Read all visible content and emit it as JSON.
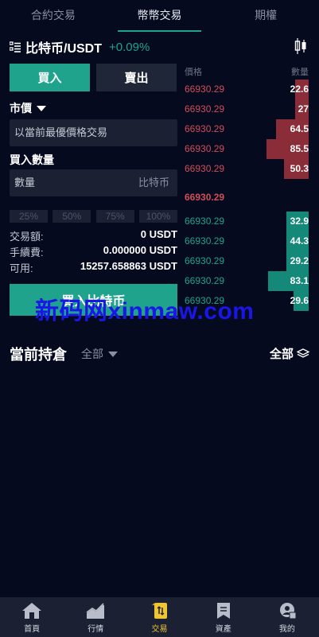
{
  "tabs": [
    "合約交易",
    "幣幣交易",
    "期權"
  ],
  "pair": {
    "name": "比特币/USDT",
    "change": "+0.09%"
  },
  "trade": {
    "buy_label": "買入",
    "sell_label": "賣出",
    "order_type": "市價",
    "price_placeholder": "以當前最優價格交易",
    "qty_label": "買入數量",
    "qty_placeholder": "數量",
    "qty_unit": "比特币",
    "percents": [
      "25%",
      "50%",
      "75%",
      "100%"
    ],
    "amount_label": "交易額:",
    "amount_value": "0 USDT",
    "fee_label": "手續費:",
    "fee_value": "0.000000 USDT",
    "avail_label": "可用:",
    "avail_value": "15257.658863 USDT",
    "submit_label": "買入比特币"
  },
  "orderbook": {
    "price_header": "價格",
    "qty_header": "數量",
    "mid_price": "66930.29",
    "asks": [
      {
        "price": "66930.29",
        "qty": "22.6",
        "depth": 0.11
      },
      {
        "price": "66930.29",
        "qty": "27",
        "depth": 0.11
      },
      {
        "price": "66930.29",
        "qty": "64.5",
        "depth": 0.26
      },
      {
        "price": "66930.29",
        "qty": "85.5",
        "depth": 0.34
      },
      {
        "price": "66930.29",
        "qty": "50.3",
        "depth": 0.2
      }
    ],
    "bids": [
      {
        "price": "66930.29",
        "qty": "32.9",
        "depth": 0.18
      },
      {
        "price": "66930.29",
        "qty": "44.3",
        "depth": 0.18
      },
      {
        "price": "66930.29",
        "qty": "29.2",
        "depth": 0.18
      },
      {
        "price": "66930.29",
        "qty": "83.1",
        "depth": 0.33
      },
      {
        "price": "66930.29",
        "qty": "29.6",
        "depth": 0.12
      }
    ]
  },
  "positions": {
    "title": "當前持倉",
    "filter": "全部",
    "all_label": "全部"
  },
  "watermark": "新码网xinmaw.com",
  "nav": [
    {
      "label": "首頁",
      "icon": "home-icon"
    },
    {
      "label": "行情",
      "icon": "chart-icon"
    },
    {
      "label": "交易",
      "icon": "trade-icon"
    },
    {
      "label": "資產",
      "icon": "wallet-icon"
    },
    {
      "label": "我的",
      "icon": "profile-icon"
    }
  ],
  "colors": {
    "accent": "#1fa38c",
    "ask": "#d14d57",
    "active_nav": "#f0c432",
    "background": "#050a1f"
  }
}
